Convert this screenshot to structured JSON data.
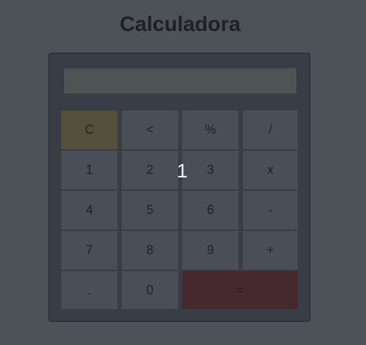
{
  "header": {
    "title": "Calculadora"
  },
  "display": {
    "value": ""
  },
  "keys": {
    "clear": "C",
    "backspace": "<",
    "percent": "%",
    "divide": "/",
    "seven": "7",
    "eight": "8",
    "nine": "9",
    "multiply": "x",
    "four": "4",
    "five": "5",
    "six": "6",
    "subtract": "-",
    "one": "1",
    "two": "2",
    "three": "3",
    "add": "+",
    "decimal": ".",
    "zero": "0",
    "equals": "="
  },
  "overlay": {
    "digit": "1"
  },
  "colors": {
    "background": "#4d5158",
    "panel": "#393d45",
    "key": "#4a4e56",
    "clear_key": "#55503c",
    "equals_key": "#45292f",
    "display": "#4e5356"
  }
}
